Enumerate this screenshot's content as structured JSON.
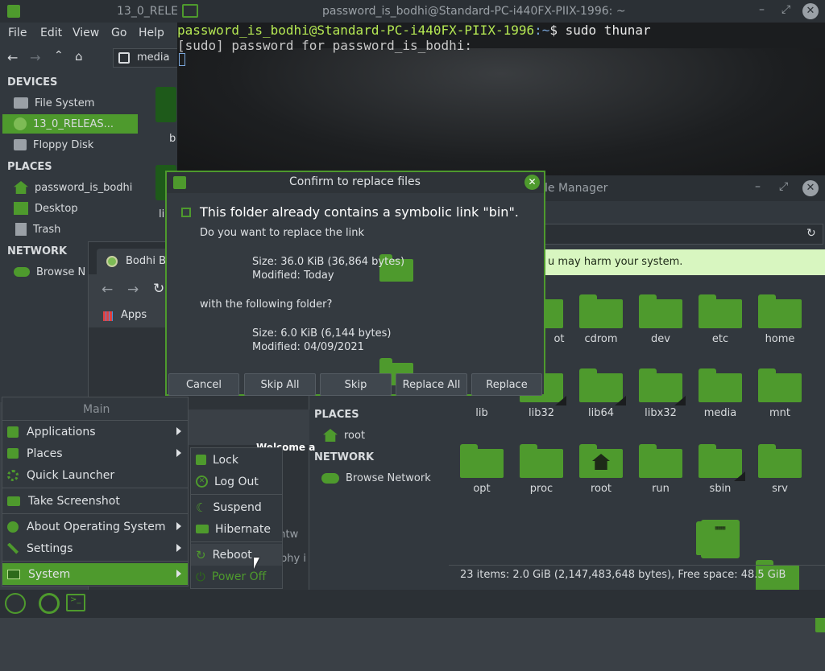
{
  "fm_back": {
    "title": "13_0_RELE",
    "menu": [
      "File",
      "Edit",
      "View",
      "Go",
      "Help"
    ],
    "path_label": "media",
    "devices_header": "DEVICES",
    "devices": [
      "File System",
      "13_0_RELEAS...",
      "Floppy Disk"
    ],
    "places_header": "PLACES",
    "places": [
      "password_is_bodhi",
      "Desktop",
      "Trash"
    ],
    "network_header": "NETWORK",
    "network": [
      "Browse N"
    ],
    "frag1": "b",
    "frag2": "li"
  },
  "terminal": {
    "title": "password_is_bodhi@Standard-PC-i440FX-PIIX-1996: ~",
    "prompt_user": "password_is_bodhi@Standard-PC-i440FX-PIIX-1996",
    "prompt_path": ":~",
    "prompt_symbol": "$ ",
    "command": "sudo thunar",
    "line2": "[sudo] password for password_is_bodhi:"
  },
  "browser": {
    "tab_title": "Bodhi B",
    "apps_label": "Apps",
    "welcome": "Welcome a",
    "frag_a": "ghtw",
    "frag_b": "phy i"
  },
  "fm_front": {
    "title_frag": "le Manager",
    "banner": "u may harm your system.",
    "places_header": "PLACES",
    "places": [
      "root"
    ],
    "network_header": "NETWORK",
    "network": [
      "Browse Network"
    ],
    "top_row": [
      {
        "name": "ot",
        "link": false
      },
      {
        "name": "cdrom",
        "link": false
      },
      {
        "name": "dev",
        "link": false
      },
      {
        "name": "etc",
        "link": false
      },
      {
        "name": "home",
        "link": false
      }
    ],
    "row2": [
      {
        "name": "lib",
        "link": true
      },
      {
        "name": "lib32",
        "link": true
      },
      {
        "name": "lib64",
        "link": true
      },
      {
        "name": "libx32",
        "link": true
      },
      {
        "name": "media",
        "link": false
      },
      {
        "name": "mnt",
        "link": false
      }
    ],
    "row3": [
      {
        "name": "opt",
        "link": false
      },
      {
        "name": "proc",
        "link": false
      },
      {
        "name": "root",
        "link": false
      },
      {
        "name": "run",
        "link": false
      },
      {
        "name": "sbin",
        "link": true
      },
      {
        "name": "srv",
        "link": false
      }
    ],
    "status": "23 items: 2.0 GiB (2,147,483,648 bytes), Free space: 48.5 GiB"
  },
  "dialog": {
    "title": "Confirm to replace files",
    "headline": "This folder already contains a symbolic link \"bin\".",
    "question": "Do you want to replace the link",
    "old_size": "Size: 36.0 KiB (36,864 bytes)",
    "old_modified": "Modified: Today",
    "with_text": "with the following folder?",
    "new_size": "Size: 6.0 KiB (6,144 bytes)",
    "new_modified": "Modified: 04/09/2021",
    "buttons": [
      "Cancel",
      "Skip All",
      "Skip",
      "Replace All",
      "Replace"
    ]
  },
  "start_menu": {
    "header": "Main",
    "items": [
      "Applications",
      "Places",
      "Quick Launcher",
      "Take Screenshot",
      "About Operating System",
      "Settings",
      "System"
    ],
    "system_sub": [
      "Lock",
      "Log Out",
      "Suspend",
      "Hibernate",
      "Reboot",
      "Power Off"
    ]
  },
  "colors": {
    "accent": "#4e9a2d",
    "prompt_green": "#b5e853",
    "path_blue": "#7aa6da"
  }
}
